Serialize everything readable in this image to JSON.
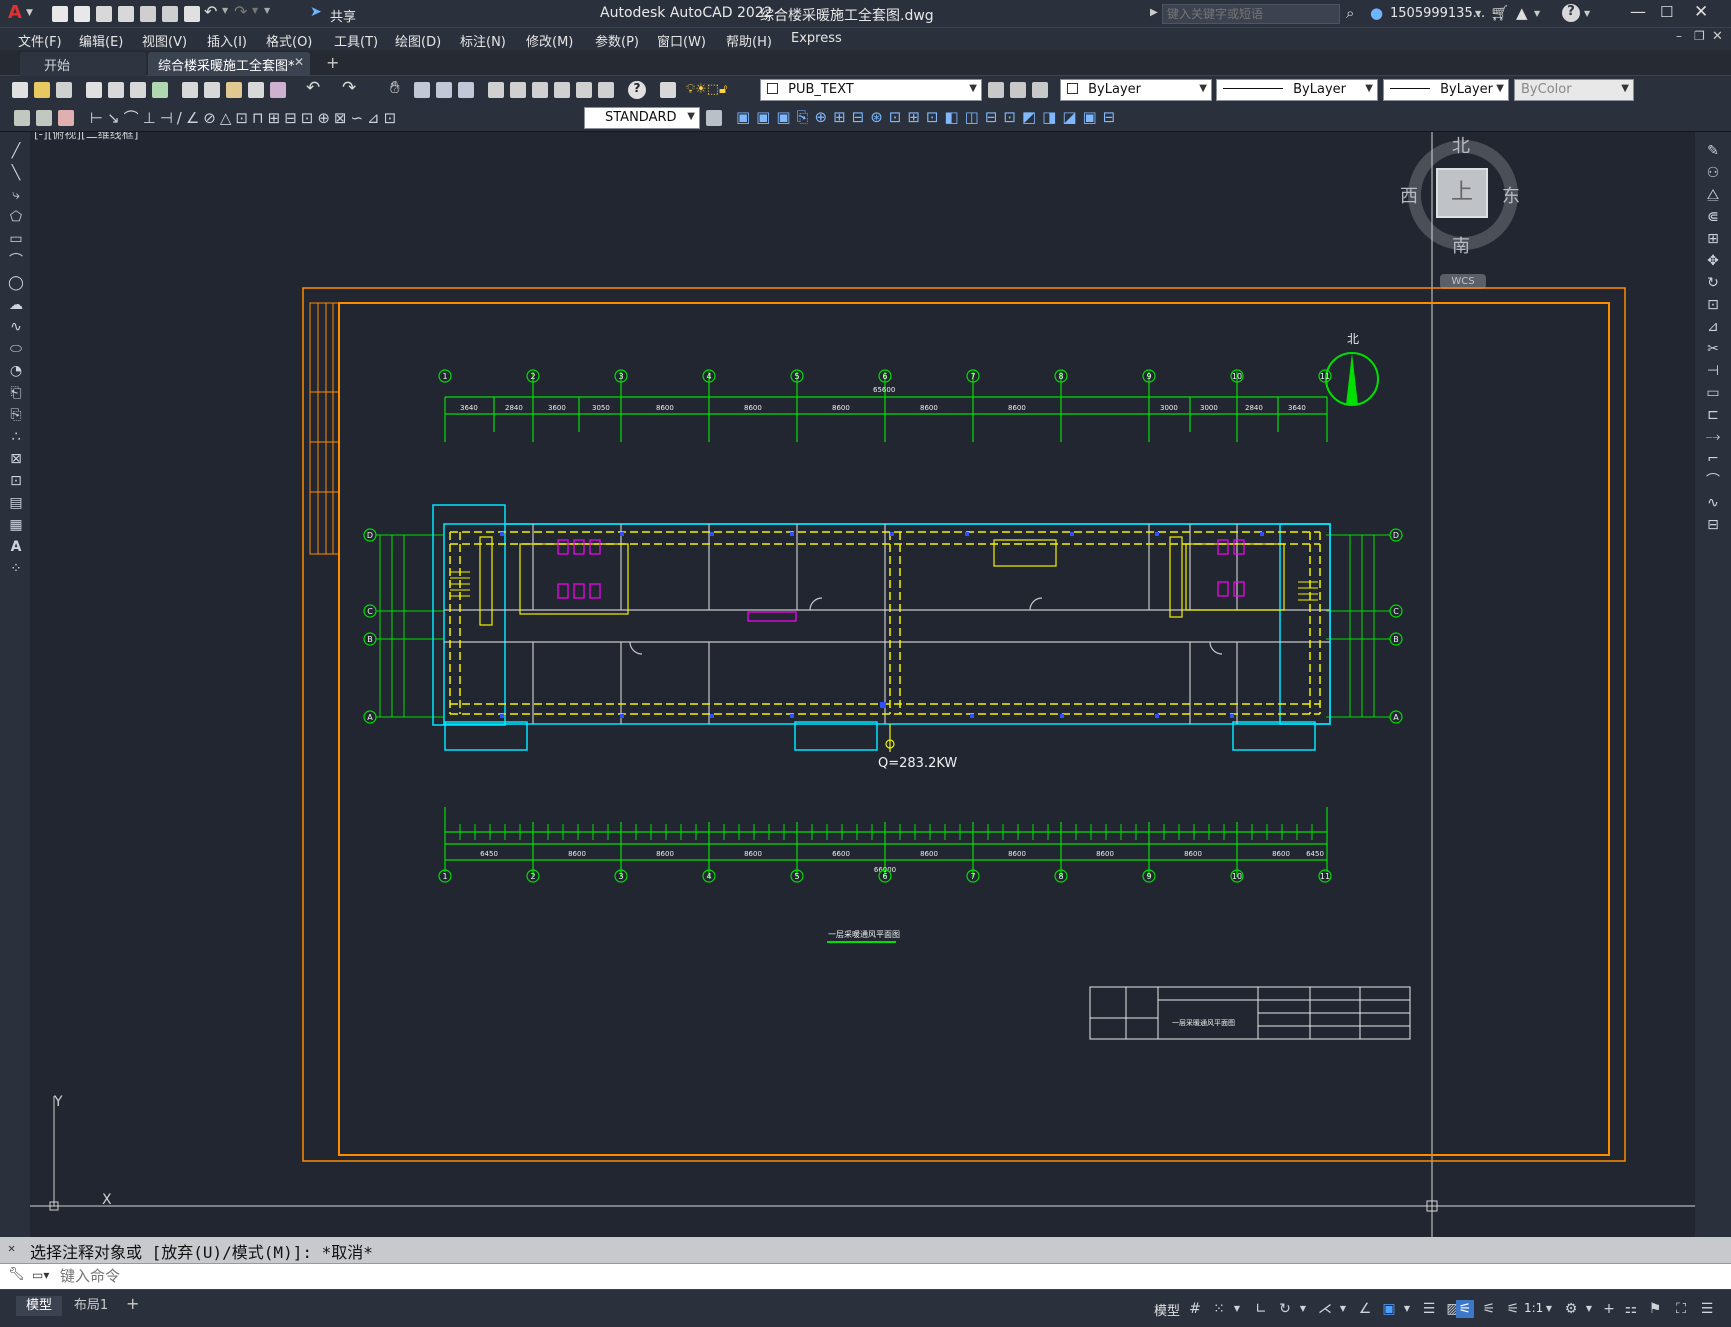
{
  "app": {
    "logo": "A",
    "title": "Autodesk AutoCAD 2022",
    "file": "综合楼采暖施工全套图.dwg",
    "share": "共享",
    "search_placeholder": "键入关键字或短语",
    "user": "1505999135...",
    "help": "?"
  },
  "menu": [
    "文件(F)",
    "编辑(E)",
    "视图(V)",
    "插入(I)",
    "格式(O)",
    "工具(T)",
    "绘图(D)",
    "标注(N)",
    "修改(M)",
    "参数(P)",
    "窗口(W)",
    "帮助(H)",
    "Express"
  ],
  "tabs": {
    "start": "开始",
    "active": "综合楼采暖施工全套图*",
    "close": "✕",
    "add": "+"
  },
  "layer": {
    "name": "PUB_TEXT"
  },
  "props": {
    "color": "ByLayer",
    "linetype": "ByLayer",
    "lineweight": "ByLayer",
    "plotstyle": "ByColor"
  },
  "textstyle": "STANDARD",
  "viewport_label": "[-][俯视][二维线框]",
  "viewcube": {
    "n": "北",
    "s": "南",
    "e": "东",
    "w": "西",
    "top": "上",
    "wcs": "WCS"
  },
  "drawing": {
    "north": "北",
    "grid_top": [
      "1",
      "2",
      "3",
      "4",
      "5",
      "6",
      "7",
      "8",
      "9",
      "10",
      "11"
    ],
    "dims_top": [
      "3640",
      "2840",
      "3600",
      "3050",
      "8600",
      "8600",
      "8600",
      "8600",
      "8600",
      "3000",
      "3000",
      "2840",
      "3640"
    ],
    "total_top": "65600",
    "rows_left": [
      "D",
      "C",
      "B",
      "A"
    ],
    "rows_right": [
      "D",
      "C",
      "B",
      "A"
    ],
    "load": "Q=283.2KW",
    "total_bottom": "66000",
    "dims_bottom": [
      "6450",
      "8600",
      "8600",
      "8600",
      "6600",
      "8600",
      "8600",
      "8600",
      "8600",
      "8600",
      "6450"
    ],
    "plan_title": "一层采暖通风平面图",
    "titleblock": {
      "main": "一层采暖通风平面图"
    }
  },
  "ucs": {
    "y": "Y",
    "x": "X"
  },
  "command": {
    "history": "选择注释对象或 [放弃(U)/模式(M)]: *取消*",
    "placeholder": "键入命令"
  },
  "layouts": {
    "model": "模型",
    "layout1": "布局1",
    "add": "+"
  },
  "status": {
    "model": "模型",
    "scale": "1:1"
  },
  "colors": {
    "bg": "#212630",
    "grid": "#00e000",
    "wall_cyan": "#00e5ff",
    "pipe_yellow": "#f3f300",
    "frame_orange": "#ff8c00",
    "magenta": "#ff00ff",
    "blue": "#3050ff"
  }
}
